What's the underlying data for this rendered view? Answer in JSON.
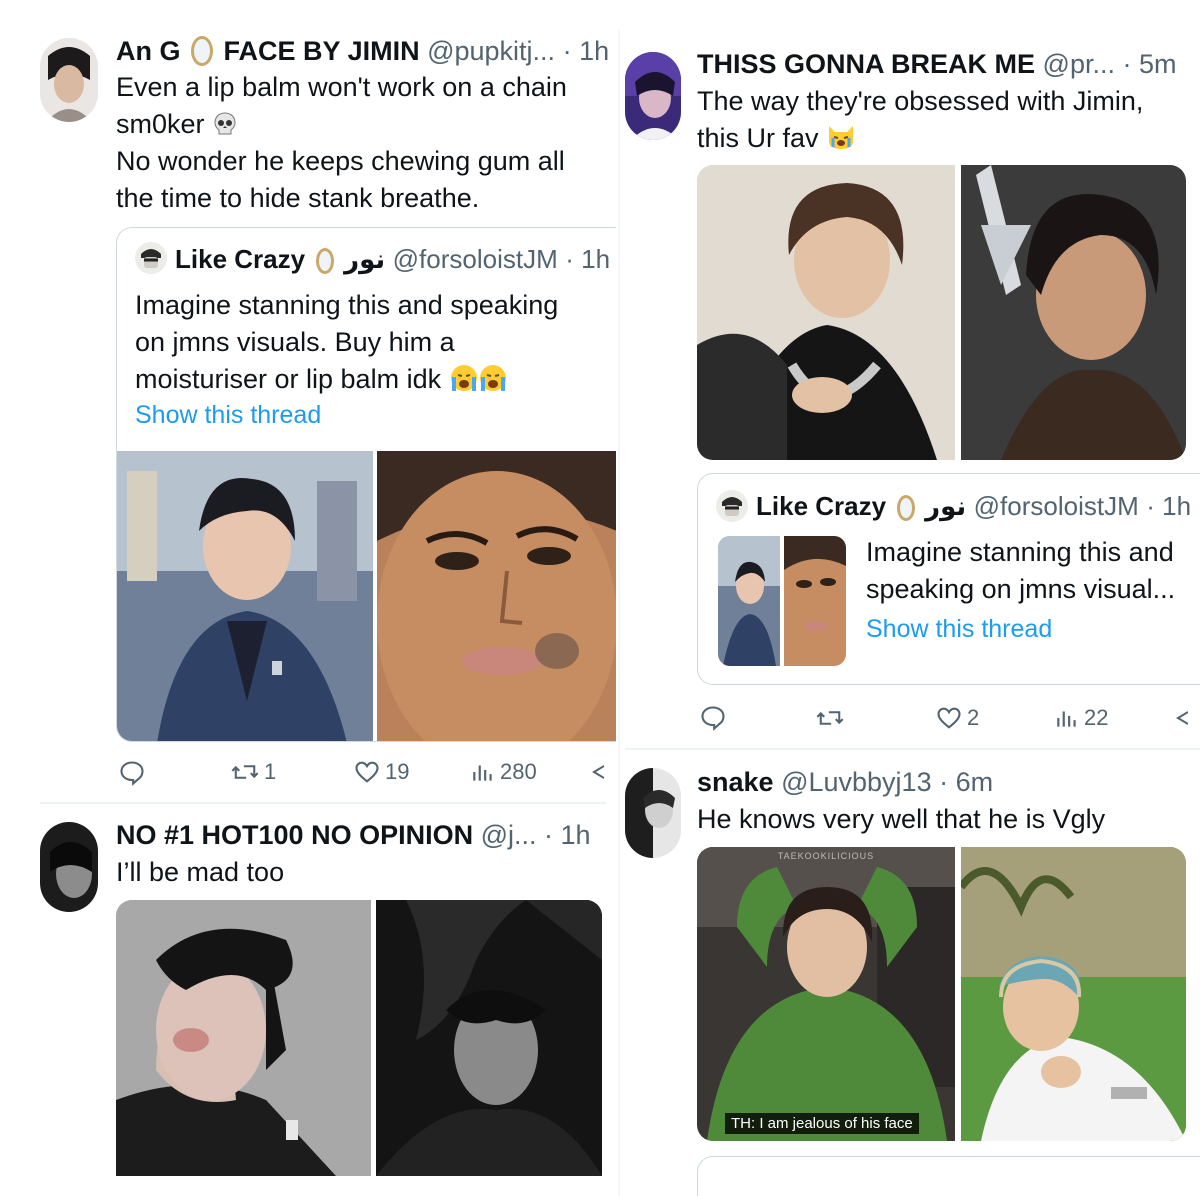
{
  "tweet1": {
    "name": "An G",
    "name_rest": "FACE BY JIMIN",
    "handle": "@pupkitj...",
    "time": "· 1h",
    "lines": [
      "Even a lip balm won't work on a chain",
      "sm0ker",
      "No wonder he keeps chewing gum all",
      "the time to hide stank breathe."
    ],
    "quote": {
      "name": "Like Crazy",
      "arabic": "نور",
      "handle": "@forsoloistJM",
      "time": "· 1h",
      "lines": [
        "Imagine stanning this and speaking",
        "on jmns visuals. Buy him a",
        "moisturiser or lip balm idk"
      ],
      "show_thread": "Show this thread"
    },
    "stats": {
      "retweets": "1",
      "likes": "19",
      "views": "280"
    }
  },
  "tweet2": {
    "name": "NO #1 HOT100 NO OPINION",
    "handle": "@j...",
    "time": "· 1h",
    "text": "I’ll be mad too"
  },
  "tweet3": {
    "name": "THISS GONNA BREAK ME",
    "handle": "@pr...",
    "time": "· 5m",
    "lines": [
      "The way they're obsessed with Jimin,",
      "this Ur fav"
    ],
    "quote": {
      "name": "Like Crazy",
      "arabic": "نور",
      "handle": "@forsoloistJM",
      "time": "· 1h",
      "lines": [
        "Imagine stanning this and",
        "speaking on jmns visual..."
      ],
      "show_thread": "Show this thread"
    },
    "stats": {
      "likes": "2",
      "views": "22"
    }
  },
  "tweet4": {
    "name": "snake",
    "handle": "@Luvbbyj13",
    "time": "· 6m",
    "text": "He knows very well that he is Vgly",
    "caption": "TH: I am jealous of his face",
    "watermark": "TAEKOOKILICIOUS"
  },
  "colors": {
    "link": "#1d9bf0",
    "muted": "#536471",
    "border": "#cfd9de"
  }
}
